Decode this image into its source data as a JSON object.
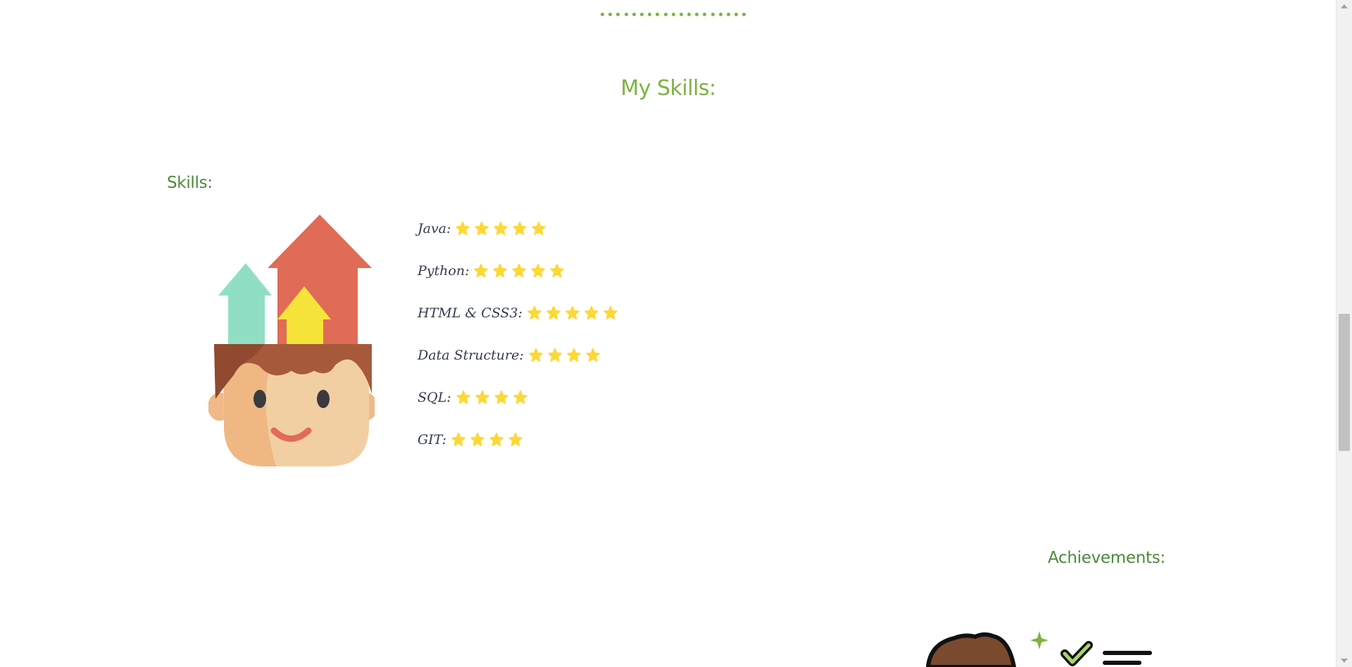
{
  "section": {
    "title": "My Skills:"
  },
  "skills": {
    "heading": "Skills:",
    "items": [
      {
        "name": "Java:",
        "stars": 5
      },
      {
        "name": "Python:",
        "stars": 5
      },
      {
        "name": "HTML & CSS3:",
        "stars": 5
      },
      {
        "name": "Data Structure:",
        "stars": 4
      },
      {
        "name": "SQL:",
        "stars": 4
      },
      {
        "name": "GIT:",
        "stars": 4
      }
    ],
    "star_color": "#fdd835",
    "illustration_icon": "growth-head-icon"
  },
  "achievements": {
    "heading": "Achievements:",
    "illustration_icon": "achievement-person-icon"
  },
  "colors": {
    "accent": "#7cb342",
    "heading_green": "#4a8a3a",
    "text": "#333c4e"
  }
}
